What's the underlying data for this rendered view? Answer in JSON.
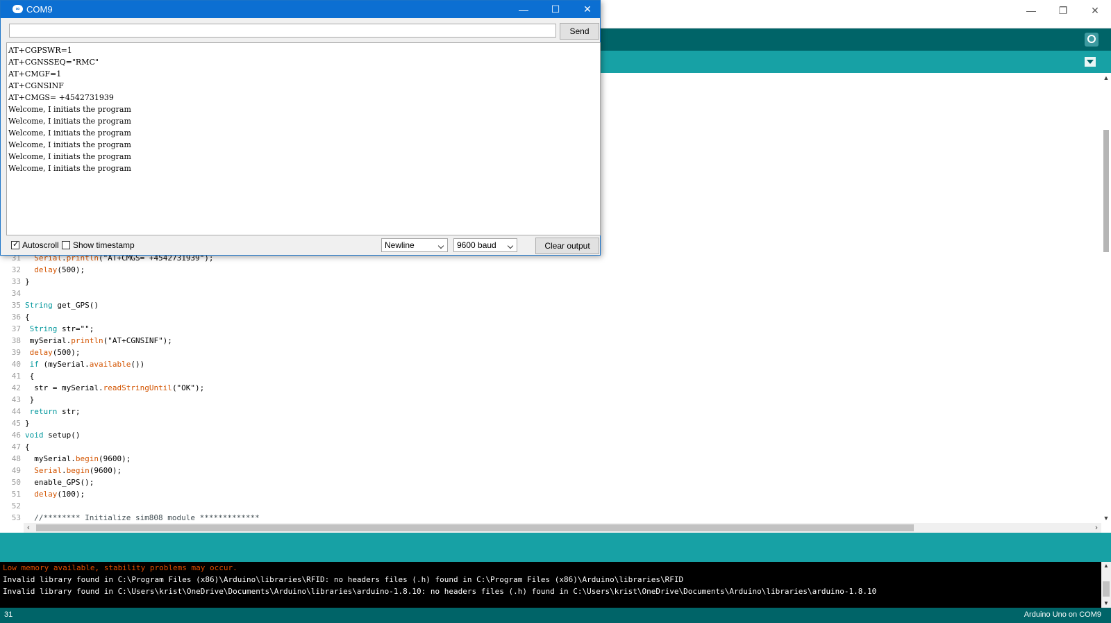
{
  "ide": {
    "status_line": "31",
    "board": "Arduino Uno on COM9",
    "code_lines": [
      {
        "n": "31",
        "text": "  Serial.println(\"AT+CMGS= +4542731939\");"
      },
      {
        "n": "32",
        "text": "  delay(500);"
      },
      {
        "n": "33",
        "text": "}"
      },
      {
        "n": "34",
        "text": ""
      },
      {
        "n": "35",
        "text": "String get_GPS()"
      },
      {
        "n": "36",
        "text": "{"
      },
      {
        "n": "37",
        "text": " String str=\"\";"
      },
      {
        "n": "38",
        "text": " mySerial.println(\"AT+CGNSINF\");"
      },
      {
        "n": "39",
        "text": " delay(500);"
      },
      {
        "n": "40",
        "text": " if (mySerial.available())"
      },
      {
        "n": "41",
        "text": " {"
      },
      {
        "n": "42",
        "text": "  str = mySerial.readStringUntil(\"OK\");"
      },
      {
        "n": "43",
        "text": " }"
      },
      {
        "n": "44",
        "text": " return str;"
      },
      {
        "n": "45",
        "text": "}"
      },
      {
        "n": "46",
        "text": "void setup()"
      },
      {
        "n": "47",
        "text": "{"
      },
      {
        "n": "48",
        "text": "  mySerial.begin(9600);"
      },
      {
        "n": "49",
        "text": "  Serial.begin(9600);"
      },
      {
        "n": "50",
        "text": "  enable_GPS();"
      },
      {
        "n": "51",
        "text": "  delay(100);"
      },
      {
        "n": "52",
        "text": ""
      },
      {
        "n": "53",
        "text": "  //******** Initialize sim808 module *************"
      }
    ],
    "console_lines": [
      {
        "text": "Low memory available, stability problems may occur.",
        "type": "warn"
      },
      {
        "text": "Invalid library found in C:\\Program Files (x86)\\Arduino\\libraries\\RFID: no headers files (.h) found in C:\\Program Files (x86)\\Arduino\\libraries\\RFID",
        "type": "info"
      },
      {
        "text": "Invalid library found in C:\\Users\\krist\\OneDrive\\Documents\\Arduino\\libraries\\arduino-1.8.10: no headers files (.h) found in C:\\Users\\krist\\OneDrive\\Documents\\Arduino\\libraries\\arduino-1.8.10",
        "type": "info"
      }
    ]
  },
  "serial_monitor": {
    "title": "COM9",
    "logo": "∞",
    "input_value": "",
    "send_label": "Send",
    "output_lines": [
      "AT+CGPSWR=1",
      "AT+CGNSSEQ=\"RMC\"",
      "AT+CMGF=1",
      "AT+CGNSINF",
      "AT+CMGS= +4542731939",
      "Welcome, I initiats the program",
      "Welcome, I initiats the program",
      "Welcome, I initiats the program",
      "Welcome, I initiats the program",
      "Welcome, I initiats the program",
      "Welcome, I initiats the program"
    ],
    "autoscroll_label": "Autoscroll",
    "autoscroll_checked": true,
    "timestamp_label": "Show timestamp",
    "timestamp_checked": false,
    "line_ending": "Newline",
    "baud": "9600 baud",
    "clear_label": "Clear output"
  },
  "icons": {
    "minimize": "—",
    "maximize": "☐",
    "close": "✕",
    "restore": "❐"
  }
}
